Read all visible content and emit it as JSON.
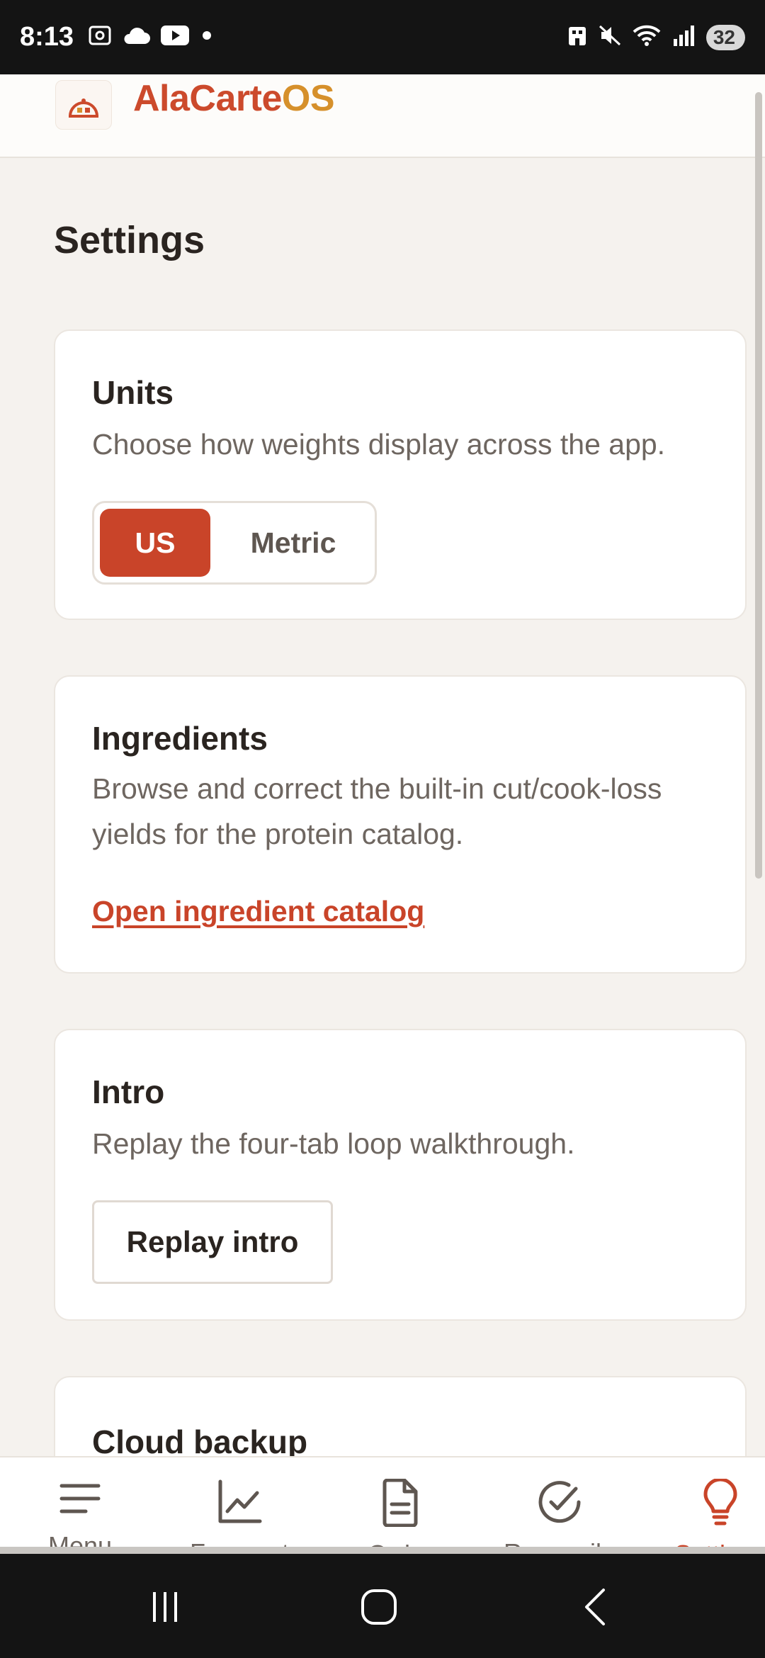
{
  "status_bar": {
    "time": "8:13",
    "battery": "32",
    "icons_left": [
      "screenshot-icon",
      "cloud-icon",
      "youtube-icon",
      "dot-icon"
    ],
    "icons_right": [
      "building-icon",
      "mute-icon",
      "wifi-icon",
      "signal-icon",
      "battery-icon"
    ]
  },
  "header": {
    "brand_part1": "AlaCarte",
    "brand_part2": "OS",
    "colors": {
      "brand_red": "#cc4a2c",
      "brand_gold": "#d6902b"
    }
  },
  "page": {
    "title": "Settings"
  },
  "units_card": {
    "title": "Units",
    "description": "Choose how weights display across the app.",
    "options": [
      "US",
      "Metric"
    ],
    "selected": "US"
  },
  "ingredients_card": {
    "title": "Ingredients",
    "description": "Browse and correct the built-in cut/cook-loss yields for the protein catalog.",
    "link": "Open ingredient catalog"
  },
  "intro_card": {
    "title": "Intro",
    "description": "Replay the four-tab loop walkthrough.",
    "button": "Replay intro"
  },
  "cloud_card": {
    "title": "Cloud backup"
  },
  "bottom_nav": {
    "items": [
      {
        "label": "Menu",
        "icon": "menu-icon"
      },
      {
        "label": "Forecast",
        "icon": "chart-icon"
      },
      {
        "label": "Order",
        "icon": "document-icon"
      },
      {
        "label": "Reconcile",
        "icon": "check-circle-icon"
      },
      {
        "label": "Settings",
        "icon": "lightbulb-icon"
      }
    ],
    "active": "Settings",
    "accent": "#c94429"
  },
  "system_nav": [
    "recents-icon",
    "home-icon",
    "back-icon"
  ]
}
